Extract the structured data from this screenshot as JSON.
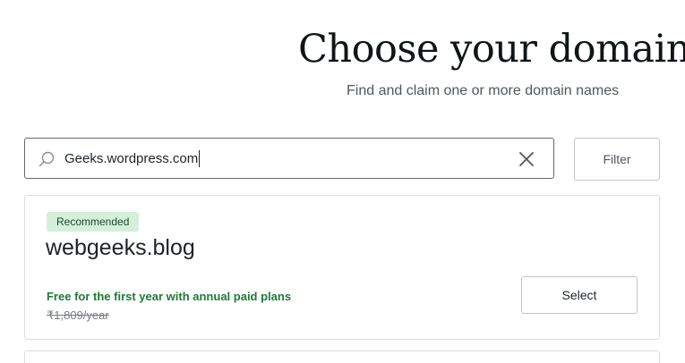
{
  "header": {
    "title": "Choose your domains",
    "subtitle": "Find and claim one or more domain names"
  },
  "search": {
    "value": "Geeks.wordpress.com",
    "icon": "search-icon",
    "clear_icon": "close-icon"
  },
  "filter": {
    "label": "Filter"
  },
  "results": [
    {
      "badge": "Recommended",
      "domain": "webgeeks.blog",
      "promo": "Free for the first year with annual paid plans",
      "old_price": "₹1,809/year",
      "action_label": "Select"
    }
  ],
  "colors": {
    "badge_bg": "#d4efdb",
    "promo_text": "#1e7a34"
  }
}
